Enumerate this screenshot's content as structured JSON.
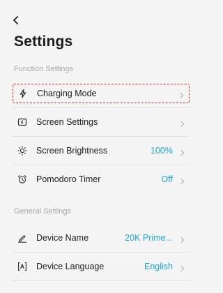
{
  "header": {
    "back_icon": "chevron-left-icon",
    "title": "Settings"
  },
  "sections": [
    {
      "label": "Function Settings",
      "items": [
        {
          "label": "Charging Mode",
          "value": "",
          "icon": "lightning-icon",
          "highlighted": true
        },
        {
          "label": "Screen Settings",
          "value": "",
          "icon": "screen-icon"
        },
        {
          "label": "Screen Brightness",
          "value": "100%",
          "icon": "brightness-icon"
        },
        {
          "label": "Pomodoro Timer",
          "value": "Off",
          "icon": "alarm-clock-icon"
        }
      ]
    },
    {
      "label": "General Settings",
      "items": [
        {
          "label": "Device Name",
          "value": "20K Prime...",
          "icon": "pencil-icon"
        },
        {
          "label": "Device Language",
          "value": "English",
          "icon": "language-icon"
        }
      ]
    }
  ],
  "colors": {
    "accent": "#1aa7d6",
    "highlight_border": "#d2262c",
    "background": "#f4f4f5"
  }
}
